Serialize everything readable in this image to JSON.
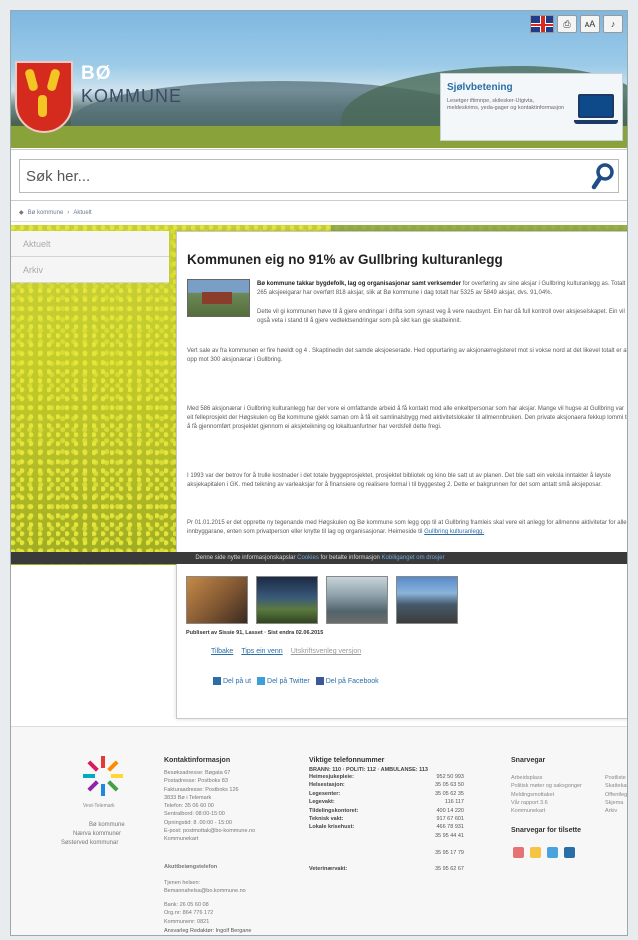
{
  "header": {
    "brand_line1": "BØ",
    "brand_line2": "KOMMUNE",
    "toolbar": {
      "lang_label": "English",
      "btn_a": "⎙",
      "btn_b": "ᴀA",
      "btn_c": "♪"
    },
    "selfservice": {
      "title": "Sjølvbetening",
      "desc": "Lesetger iftimnpe, skilesker-Utgivta, meldeskrims, yeda-gager og kontaktinformasjon"
    }
  },
  "search": {
    "placeholder": "Søk her..."
  },
  "breadcrumb": {
    "home": "Bø kommune",
    "sep": "›",
    "current": "Aktuelt"
  },
  "sidenav": {
    "items": [
      {
        "label": "Aktuelt"
      },
      {
        "label": "Arkiv"
      }
    ]
  },
  "article": {
    "title": "Kommunen eig no 91% av Gullbring kulturanlegg",
    "lead_bold": "Bø kommune takkar bygdefolk, lag og organisasjonar samt verksemder",
    "lead_rest": "for overføring av sine aksjar i Gullbring kulturanlegg as. Totalt 265 aksjeeigarar har overført 818 aksjar, slik at Bø kommune i dag totalt har 5325 av 5849 aksjar, dvs. 91,04%.",
    "p1": "Dette vil gi kommunen høve til å gjere endringar i drifta som synast veg å vere naudsynt. Ein har då full kontroll over aksjeselskapet. Ein vil også veta i stand til å gjere vedtektsendringar som på sikt kan gje skatteinnit.",
    "p2": "Vert sale av fra kommunen er fire høeldt og 4 . Skaptinedin det samde aksjoeserade. Hed oppurtaring av aksjonærregisteret mot si vokse nord at det likevel totalt er att opp mot 300 aksjonærar i Gullbring.",
    "p3": "Med 586 aksjonærar i Gullbring kulturanlegg har der vore ei omfattande arbeid å få kontakt mod alle enkeltpersonar som har aksjar. Mange vil hugse at Gullbring var eit felleprosjekt der Høgskulen og Bø kommune gjekk saman om å få eit samlinalsbygg med aktivitetslokaler til allmennbruken. Den private aksjonaera fekkup lommi til å få gjennomført prosjektet gjennom ei aksjeteikning og lokaltuanfurtner har verdsfell dette fregi.",
    "p4": "I 1993 var der betrov for å trulle kostnader i det totale byggeprosjektet, prosjektet bibliotek og kino ble satt ut av planen. Det ble satt ein veksla inntakter å løyste aksjekapitalen i GK. med teikning av varleaksjar for å finansiere og realisere formal i til byggesteg 2. Dette er bakgrunnen for det som antatt små aksjeposar.",
    "p5_prefix": "Pr 01.01.2015 er det opprette ny tegenande med Høgskulen og Bø kommune som legg opp til at Gullbring framleis skal vere eit anlegg for allmenne aktivitetar for alle innbyggarane, enten som privatperson eller knytte til lag og organisasjonar. Heimeside til",
    "p5_link": "Gullbring kulturanlegg.",
    "caption": "Publisert av Sissie 91, Lasset · Sist endra 02.06.2015",
    "links": [
      "Tilbake",
      "Tips ein venn",
      "Utskriftsvenleg versjon"
    ],
    "share": [
      "Del på ut",
      "Del på Twitter",
      "Del på Facebook"
    ]
  },
  "cookie": {
    "text": "Denne side nytte informasjonskapslar",
    "link1": "Cookies",
    "mid": "for betalte informasjon",
    "link2": "Kobiliganget om drosjer"
  },
  "footer": {
    "logo_caption": "Vest-Telemark",
    "links": [
      "Bø kommune",
      "Nærva kommuner",
      "Søsterved kommunar"
    ],
    "contact_title": "Kontaktinformasjon",
    "contact_lines": [
      "Besøksadresse: Bøgata 67",
      "Postadresse: Postboks 83",
      "Fakturaadresse: Postboks 126",
      "3833 Bø i Telemark",
      "Telefon: 35 06 60 00",
      "Sentralbord: 08:00-15:00",
      "Opningstid: 8 .00:00 - 15:00",
      "E-post: postmottak@bo-kommune.no",
      "Kommunekart"
    ],
    "alarm": "Akuttbeiøngstelefon",
    "alarm_lines": [
      "Tjenen helsen:",
      "Bemannahelsa@bo.kommune.no"
    ],
    "bank_lines": [
      "Bank: 26 05 60 08",
      "Org.nr: 864 776 172",
      "Kommunenr: 0821"
    ],
    "editor": "Ansvarleg Redaktør: Ingolf Bergane",
    "phone_title": "Viktige telefonnummer",
    "phone_header": "BRANN: 110 · POLITI: 112 · AMBULANSE: 113",
    "phones": [
      {
        "k": "Heimesjukepleie:",
        "v": "952 50 993"
      },
      {
        "k": "Helsestasjon:",
        "v": "35 05 63 50"
      },
      {
        "k": "Legesenter:",
        "v": "35 05 62 35"
      },
      {
        "k": "Legevakt:",
        "v": "116 117"
      },
      {
        "k": "Tildelingskontoret:",
        "v": "400 14 220"
      },
      {
        "k": "Teknisk vakt:",
        "v": "917 67 601"
      },
      {
        "k": "Lokale krisehust:",
        "v": "466 78 931"
      },
      {
        "k": "",
        "v": "35 95 44 41"
      },
      {
        "k": "",
        "v": ""
      },
      {
        "k": "",
        "v": "35 95 17 79"
      },
      {
        "k": "",
        "v": ""
      },
      {
        "k": "Veterinærvakt:",
        "v": "35 95 62 67"
      }
    ],
    "shortcuts_title": "Snarvegar",
    "shortcuts": [
      "Arbeidsplass",
      "Politisk møter og saksgonger",
      "Meldingsmottaket",
      "Vår rapport 3.6",
      "Kommunekart"
    ],
    "shortcuts_right": [
      "Postliste",
      "Skattekart",
      "Offentleg",
      "Skjema",
      "Arkiv"
    ],
    "social_title": "Snarvegar for tilsette",
    "colors": {
      "accent": "#2a6ea8",
      "crest_red": "#d52b1e",
      "brand_navy": "#3b4b66"
    }
  }
}
